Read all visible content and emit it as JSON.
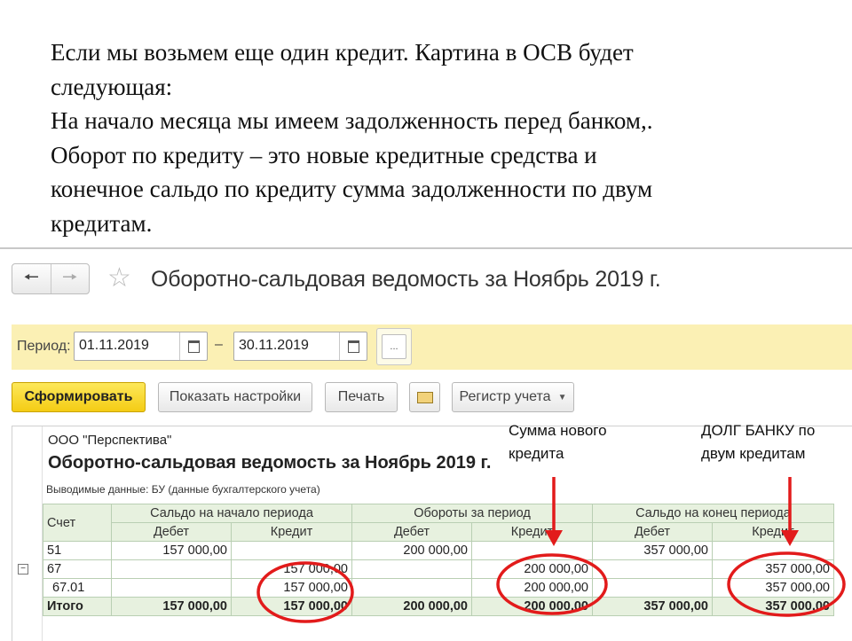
{
  "slide": {
    "lines": [
      "Если мы возьмем еще один кредит. Картина в ОСВ будет",
      "следующая:",
      "На начало месяца мы имеем задолженность перед банком,.",
      "Оборот по кредиту – это новые кредитные средства и",
      "конечное сальдо по кредиту сумма задолженности по двум",
      "кредитам."
    ]
  },
  "app": {
    "title": "Оборотно-сальдовая ведомость за Ноябрь 2019 г.",
    "nav": {
      "back_icon": "arrow-left-icon",
      "forward_icon": "arrow-right-icon",
      "favorite_icon": "star-icon"
    }
  },
  "period": {
    "label": "Период:",
    "from": "01.11.2019",
    "separator": "–",
    "to": "30.11.2019",
    "more": "..."
  },
  "toolbar": {
    "generate": "Сформировать",
    "settings": "Показать настройки",
    "print": "Печать",
    "email_icon": "envelope-icon",
    "register": "Регистр учета"
  },
  "report": {
    "organization": "ООО \"Перспектива\"",
    "title": "Оборотно-сальдовая ведомость за Ноябрь 2019 г.",
    "data_info": "Выводимые данные:  БУ (данные бухгалтерского учета)",
    "headers": {
      "account": "Счет",
      "opening": "Сальдо на начало периода",
      "turnover": "Обороты за период",
      "closing": "Сальдо на конец периода",
      "debit": "Дебет",
      "credit": "Кредит"
    },
    "rows": [
      {
        "account": "51",
        "open_dt": "157 000,00",
        "open_kt": "",
        "turn_dt": "200 000,00",
        "turn_kt": "",
        "close_dt": "357 000,00",
        "close_kt": ""
      },
      {
        "account": "67",
        "open_dt": "",
        "open_kt": "157 000,00",
        "turn_dt": "",
        "turn_kt": "200 000,00",
        "close_dt": "",
        "close_kt": "357 000,00"
      },
      {
        "account": "67.01",
        "open_dt": "",
        "open_kt": "157 000,00",
        "turn_dt": "",
        "turn_kt": "200 000,00",
        "close_dt": "",
        "close_kt": "357 000,00"
      }
    ],
    "total": {
      "account": "Итого",
      "open_dt": "157 000,00",
      "open_kt": "157 000,00",
      "turn_dt": "200 000,00",
      "turn_kt": "200 000,00",
      "close_dt": "357 000,00",
      "close_kt": "357 000,00"
    }
  },
  "annotations": {
    "new_credit": [
      "Сумма нового",
      "кредита"
    ],
    "bank_debt": [
      "ДОЛГ БАНКУ по",
      "двум кредитам"
    ],
    "color": "#e21b1b"
  },
  "colors": {
    "period_bar": "#fbf0b4",
    "primary_button": "#f4cc14",
    "table_header": "#e7f1df",
    "table_border": "#b9cfb3"
  }
}
